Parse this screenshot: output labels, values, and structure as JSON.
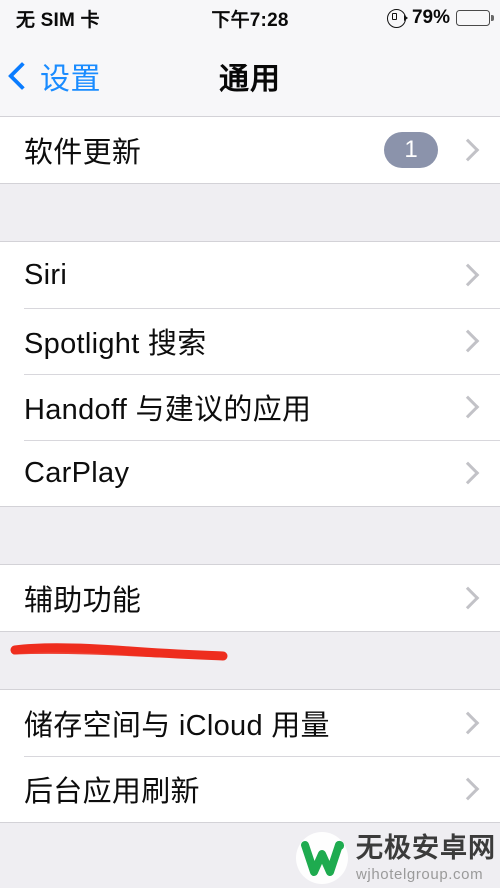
{
  "status_bar": {
    "carrier": "无 SIM 卡",
    "time": "下午7:28",
    "rotation_lock_icon": "rotation-lock-icon",
    "battery_percent": "79%",
    "battery_level": 79
  },
  "nav_bar": {
    "back_label": "设置",
    "back_icon": "chevron-left-icon",
    "title": "通用"
  },
  "colors": {
    "accent_blue": "#1a8cff",
    "badge_gray_blue": "#8b93ab",
    "chevron_gray": "#c2c2c7",
    "page_background": "#efeef2",
    "row_background": "#ffffff",
    "annotation_red": "#ee2d1e",
    "watermark_green": "#1eab4f"
  },
  "groups": [
    {
      "name": "software-update-group",
      "rows": [
        {
          "label": "软件更新",
          "badge": "1",
          "chevron": true
        }
      ]
    },
    {
      "name": "services-group",
      "rows": [
        {
          "label": "Siri",
          "badge": null,
          "chevron": true
        },
        {
          "label": "Spotlight 搜索",
          "badge": null,
          "chevron": true
        },
        {
          "label": "Handoff 与建议的应用",
          "badge": null,
          "chevron": true
        },
        {
          "label": "CarPlay",
          "badge": null,
          "chevron": true
        }
      ]
    },
    {
      "name": "accessibility-group",
      "rows": [
        {
          "label": "辅助功能",
          "badge": null,
          "chevron": true
        }
      ]
    },
    {
      "name": "storage-group",
      "rows": [
        {
          "label": "储存空间与 iCloud 用量",
          "badge": null,
          "chevron": true
        },
        {
          "label": "后台应用刷新",
          "badge": null,
          "chevron": true
        }
      ]
    }
  ],
  "annotation": {
    "type": "hand-drawn-underline",
    "color": "#ee2d1e",
    "targets_row": "辅助功能"
  },
  "watermark": {
    "logo_icon": "w-logo-icon",
    "title": "无极安卓网",
    "url": "wjhotelgroup.com"
  }
}
